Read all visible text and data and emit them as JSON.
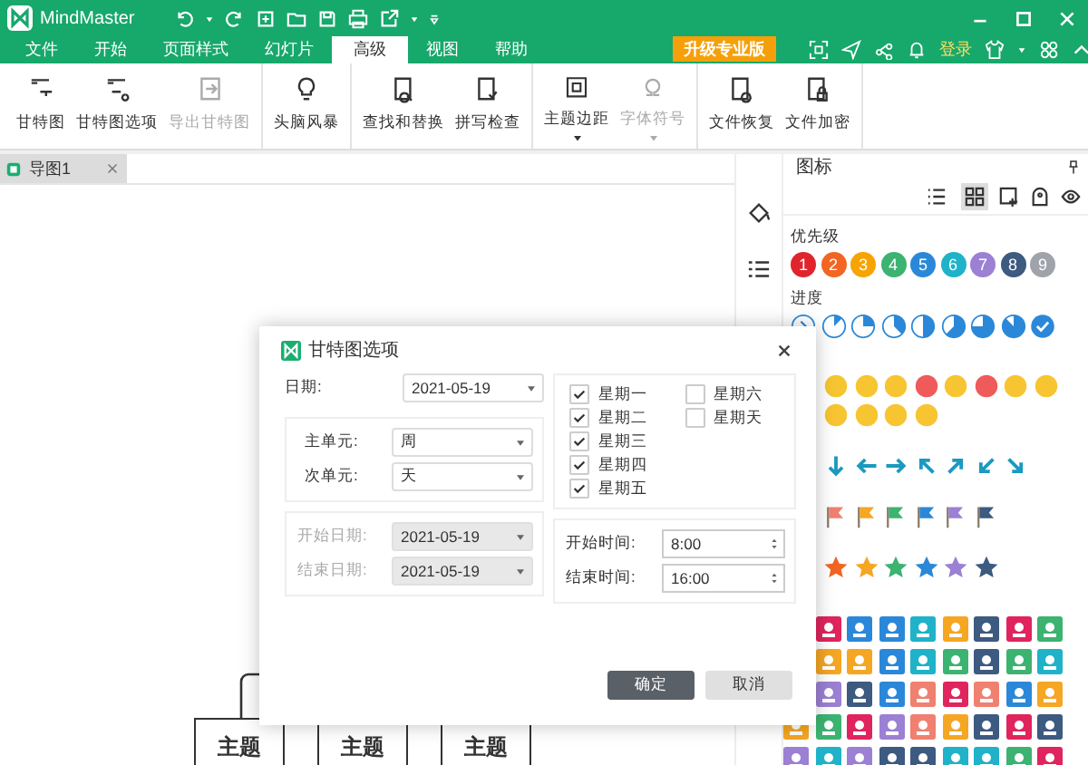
{
  "window": {
    "app_name": "MindMaster"
  },
  "menu_tabs": [
    {
      "label": "文件",
      "selected": false
    },
    {
      "label": "开始",
      "selected": false
    },
    {
      "label": "页面样式",
      "selected": false
    },
    {
      "label": "幻灯片",
      "selected": false
    },
    {
      "label": "高级",
      "selected": true
    },
    {
      "label": "视图",
      "selected": false
    },
    {
      "label": "帮助",
      "selected": false
    }
  ],
  "upgrade_button": "升级专业版",
  "login": "登录",
  "ribbon_groups": [
    {
      "buttons": [
        {
          "label": "甘特图",
          "disabled": false,
          "dropdown": false
        },
        {
          "label": "甘特图选项",
          "disabled": false,
          "dropdown": false
        },
        {
          "label": "导出甘特图",
          "disabled": true,
          "dropdown": false
        }
      ]
    },
    {
      "buttons": [
        {
          "label": "头脑风暴",
          "disabled": false,
          "dropdown": false
        }
      ]
    },
    {
      "buttons": [
        {
          "label": "查找和替换",
          "disabled": false,
          "dropdown": false
        },
        {
          "label": "拼写检查",
          "disabled": false,
          "dropdown": false
        }
      ]
    },
    {
      "buttons": [
        {
          "label": "主题边距",
          "disabled": false,
          "dropdown": true
        },
        {
          "label": "字体符号",
          "disabled": true,
          "dropdown": true
        }
      ]
    },
    {
      "buttons": [
        {
          "label": "文件恢复",
          "disabled": false,
          "dropdown": false
        },
        {
          "label": "文件加密",
          "disabled": false,
          "dropdown": false
        }
      ]
    }
  ],
  "document_tabs": [
    {
      "label": "导图1",
      "selected": true
    }
  ],
  "canvas": {
    "topics": [
      "主题",
      "主题",
      "主题"
    ]
  },
  "side_panel": {
    "title": "图标",
    "view_toggle": [
      {
        "selected": false
      },
      {
        "selected": true
      }
    ]
  },
  "priority": {
    "label": "优先级",
    "items": [
      {
        "text": "1",
        "color": "#e0242c"
      },
      {
        "text": "2",
        "color": "#f26522"
      },
      {
        "text": "3",
        "color": "#f7a300"
      },
      {
        "text": "4",
        "color": "#3cb371"
      },
      {
        "text": "5",
        "color": "#2b88d8"
      },
      {
        "text": "6",
        "color": "#1fb2c8"
      },
      {
        "text": "7",
        "color": "#9b80d4"
      },
      {
        "text": "8",
        "color": "#3d5a80"
      },
      {
        "text": "9",
        "color": "#a0a4aa"
      }
    ]
  },
  "progress": {
    "label": "进度",
    "items": [
      {
        "kind": "start"
      },
      {
        "kind": "eighth"
      },
      {
        "kind": "quarter"
      },
      {
        "kind": "three-eighths"
      },
      {
        "kind": "half"
      },
      {
        "kind": "five-eighths"
      },
      {
        "kind": "three-quarters"
      },
      {
        "kind": "seven-eighths"
      },
      {
        "kind": "done"
      }
    ]
  },
  "emoji_rows": [
    [
      {
        "color": "#f7c531"
      },
      {
        "color": "#f7c531"
      },
      {
        "color": "#f7c531"
      },
      {
        "color": "#ef5a5a"
      },
      {
        "color": "#f7c531"
      },
      {
        "color": "#ef5a5a"
      },
      {
        "color": "#f7c531"
      },
      {
        "color": "#f7c531"
      }
    ],
    [
      {
        "color": "#f7c531"
      },
      {
        "color": "#f7c531"
      },
      {
        "color": "#f7c531"
      },
      {
        "color": "#f7c531"
      }
    ]
  ],
  "arrows": [
    {
      "kind": "down"
    },
    {
      "kind": "left"
    },
    {
      "kind": "right"
    },
    {
      "kind": "up-left"
    },
    {
      "kind": "up-right"
    },
    {
      "kind": "down-left"
    },
    {
      "kind": "down-right"
    }
  ],
  "flags": [
    {
      "color": "#f08070"
    },
    {
      "color": "#f5a623"
    },
    {
      "color": "#3cb371"
    },
    {
      "color": "#2b88d8"
    },
    {
      "color": "#9b80d4"
    },
    {
      "color": "#3d5a80"
    }
  ],
  "stars": [
    {
      "color": "#f26522"
    },
    {
      "color": "#f5a623"
    },
    {
      "color": "#3cb371"
    },
    {
      "color": "#2b88d8"
    },
    {
      "color": "#9b80d4"
    },
    {
      "color": "#3d5a80"
    }
  ],
  "sticker_rows": [
    [
      {
        "color": "#e0245e"
      },
      {
        "color": "#2b88d8"
      },
      {
        "color": "#2b88d8"
      },
      {
        "color": "#1fb2c8"
      },
      {
        "color": "#f5a623"
      },
      {
        "color": "#3d5a80"
      },
      {
        "color": "#e0245e"
      },
      {
        "color": "#3cb371"
      }
    ],
    [
      {
        "color": "#f5a623"
      },
      {
        "color": "#f5a623"
      },
      {
        "color": "#2b88d8"
      },
      {
        "color": "#1fb2c8"
      },
      {
        "color": "#3cb371"
      },
      {
        "color": "#3d5a80"
      },
      {
        "color": "#3cb371"
      },
      {
        "color": "#1fb2c8"
      }
    ],
    [
      {
        "color": "#9b80d4"
      },
      {
        "color": "#3d5a80"
      },
      {
        "color": "#2b88d8"
      },
      {
        "color": "#f08070"
      },
      {
        "color": "#e0245e"
      },
      {
        "color": "#f08070"
      },
      {
        "color": "#2b88d8"
      },
      {
        "color": "#f5a623"
      }
    ],
    [
      {
        "color": "#f5a623"
      },
      {
        "color": "#3cb371"
      },
      {
        "color": "#e0245e"
      },
      {
        "color": "#9b80d4"
      },
      {
        "color": "#f08070"
      },
      {
        "color": "#f5a623"
      },
      {
        "color": "#3d5a80"
      },
      {
        "color": "#e0245e"
      },
      {
        "color": "#3d5a80"
      }
    ],
    [
      {
        "color": "#9b80d4"
      },
      {
        "color": "#1fb2c8"
      },
      {
        "color": "#9b80d4"
      },
      {
        "color": "#3d5a80"
      },
      {
        "color": "#3d5a80"
      },
      {
        "color": "#1fb2c8"
      },
      {
        "color": "#1fb2c8"
      },
      {
        "color": "#3cb371"
      },
      {
        "color": "#e0245e"
      }
    ]
  ],
  "dialog": {
    "title": "甘特图选项",
    "date": {
      "label": "日期:",
      "value": "2021-05-19"
    },
    "units": [
      {
        "label": "主单元:",
        "value": "周"
      },
      {
        "label": "次单元:",
        "value": "天"
      }
    ],
    "range": {
      "disabled": true,
      "fields": [
        {
          "label": "开始日期:",
          "value": "2021-05-19"
        },
        {
          "label": "结束日期:",
          "value": "2021-05-19"
        }
      ]
    },
    "weekdays": [
      {
        "label": "星期一",
        "checked": true
      },
      {
        "label": "星期二",
        "checked": true
      },
      {
        "label": "星期三",
        "checked": true
      },
      {
        "label": "星期四",
        "checked": true
      },
      {
        "label": "星期五",
        "checked": true
      },
      {
        "label": "星期六",
        "checked": false
      },
      {
        "label": "星期天",
        "checked": false
      }
    ],
    "times": [
      {
        "label": "开始时间:",
        "value": "8:00"
      },
      {
        "label": "结束时间:",
        "value": "16:00"
      }
    ],
    "buttons": [
      {
        "label": "确定",
        "primary": true
      },
      {
        "label": "取消",
        "primary": false
      }
    ]
  }
}
